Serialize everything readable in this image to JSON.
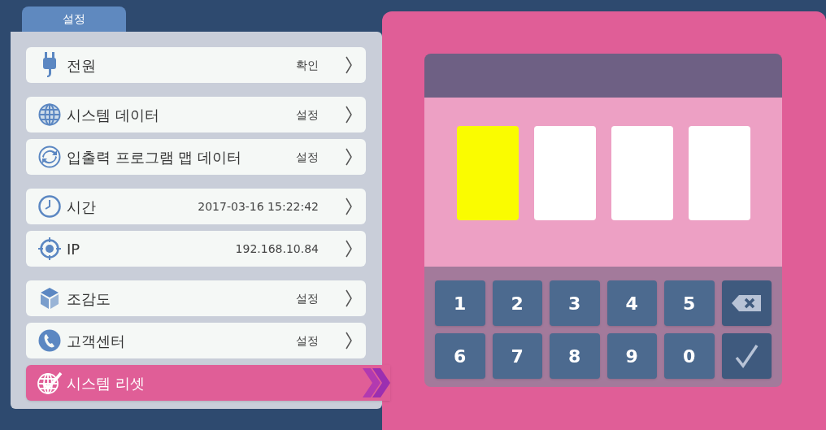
{
  "tab": {
    "label": "설정",
    "selected": true
  },
  "menu_groups": [
    [
      {
        "label": "전원",
        "value": "확인",
        "selected": false
      }
    ],
    [
      {
        "label": "시스템 데이터",
        "value": "설정",
        "selected": false
      },
      {
        "label": "입출력 프로그램 맵 데이터",
        "value": "설정",
        "selected": false
      }
    ],
    [
      {
        "label": "시간",
        "value": "2017-03-16 15:22:42",
        "selected": false
      },
      {
        "label": "IP",
        "value": "192.168.10.84",
        "selected": false
      }
    ],
    [
      {
        "label": "조감도",
        "value": "설정",
        "selected": false
      },
      {
        "label": "고객센터",
        "value": "설정",
        "selected": false
      },
      {
        "label": "시스템 리셋",
        "selected": true
      }
    ]
  ],
  "pin_boxes": [
    {
      "selected": true
    },
    {
      "selected": false
    },
    {
      "selected": false
    },
    {
      "selected": false
    }
  ],
  "keypad": [
    {
      "kind": "digit",
      "label": "1"
    },
    {
      "kind": "digit",
      "label": "2"
    },
    {
      "kind": "digit",
      "label": "3"
    },
    {
      "kind": "digit",
      "label": "4"
    },
    {
      "kind": "digit",
      "label": "5"
    },
    {
      "kind": "backspace"
    },
    {
      "kind": "digit",
      "label": "6"
    },
    {
      "kind": "digit",
      "label": "7"
    },
    {
      "kind": "digit",
      "label": "8"
    },
    {
      "kind": "digit",
      "label": "9"
    },
    {
      "kind": "digit",
      "label": "0"
    },
    {
      "kind": "confirm"
    }
  ]
}
